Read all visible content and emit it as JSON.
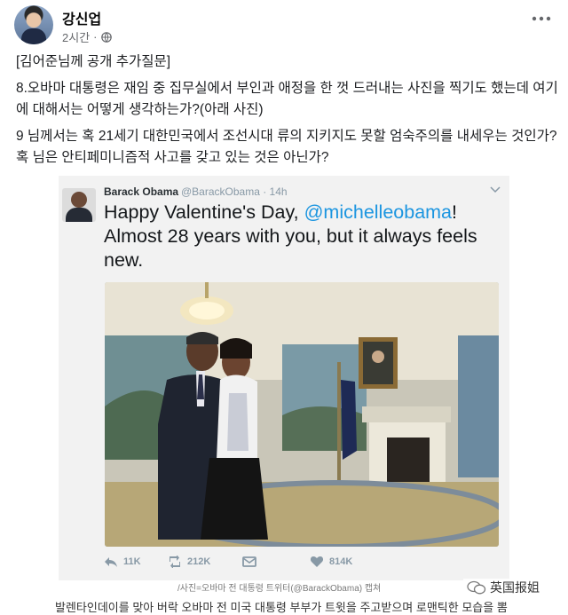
{
  "post": {
    "author": "강신업",
    "time": "2시간",
    "paragraphs": [
      "[김어준님께 공개 추가질문]",
      "8.오바마 대통령은 재임 중 집무실에서 부인과 애정을 한 껏 드러내는 사진을 찍기도 했는데 여기에 대해서는 어떻게 생각하는가?(아래 사진)",
      "9 님께서는 혹 21세기 대한민국에서 조선시대 류의 지키지도 못할 엄숙주의를 내세우는 것인가? 혹 님은 안티페미니즘적 사고를 갖고 있는 것은 아닌가?"
    ]
  },
  "tweet": {
    "name": "Barack Obama",
    "handle": "@BarackObama · 14h",
    "text_before": "Happy Valentine's Day, ",
    "mention": "@michelleobama",
    "text_after": "! Almost 28 years with you, but it always feels new.",
    "reply_count": "11K",
    "retweet_count": "212K",
    "like_count": "814K"
  },
  "caption": "/사진=오바마 전 대통령 트위터(@BarackObama) 캡쳐",
  "bottom_text": "발렌타인데이를 맞아 버락 오바마 전 미국 대통령 부부가 트윗을 주고받으며 로맨틱한 모습을 뽐",
  "watermark": "英国报姐",
  "icons": {
    "globe": "globe-icon",
    "more": "more-options-icon",
    "chevron": "chevron-down-icon",
    "reply": "reply-icon",
    "retweet": "retweet-icon",
    "dm": "direct-message-icon",
    "like": "heart-icon"
  },
  "colors": {
    "mention": "#1b95e0",
    "meta": "#65676b",
    "tweet_meta": "#8899a6"
  }
}
